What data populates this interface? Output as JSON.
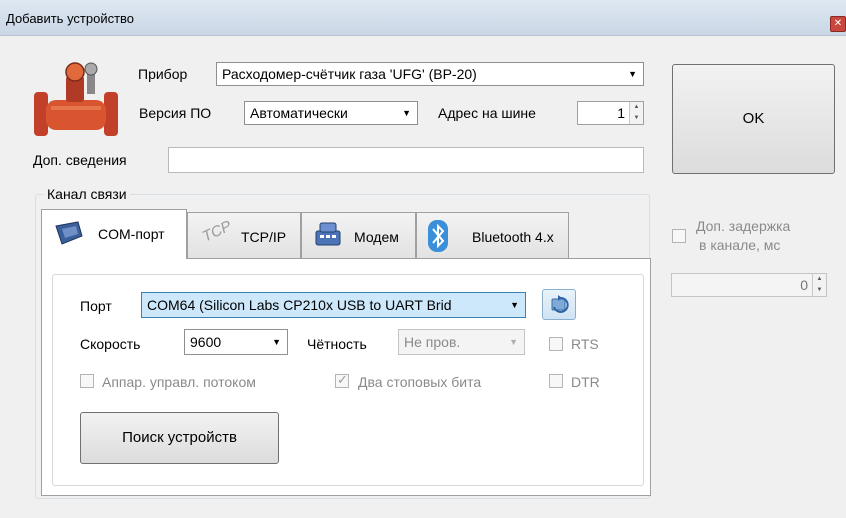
{
  "window": {
    "title": "Добавить устройство",
    "close_glyph": "✕"
  },
  "device": {
    "label": "Прибор",
    "selected": "Расходомер-счётчик газа 'UFG' (ВР-20)",
    "image_icon": "gas-flow-meter-image"
  },
  "firmware": {
    "label": "Версия ПО",
    "selected": "Автоматически"
  },
  "bus_address": {
    "label": "Адрес на шине",
    "value": "1"
  },
  "extra_info": {
    "label": "Доп. сведения",
    "value": ""
  },
  "ok_button": {
    "label": "OK"
  },
  "channel": {
    "group_title": "Канал связи",
    "tabs": [
      {
        "label": "COM-порт",
        "icon": "com-port-icon",
        "active": true
      },
      {
        "label": "TCP/IP",
        "icon": "tcp-icon",
        "active": false
      },
      {
        "label": "Модем",
        "icon": "modem-icon",
        "active": false
      },
      {
        "label": "Bluetooth 4.x",
        "icon": "bluetooth-icon",
        "active": false
      }
    ]
  },
  "com": {
    "port_label": "Порт",
    "port_selected": "COM64 (Silicon Labs CP210x USB to UART Brid",
    "refresh_icon": "refresh-icon",
    "speed_label": "Скорость",
    "speed_selected": "9600",
    "parity_label": "Чётность",
    "parity_selected": "Не пров.",
    "rts_label": "RTS",
    "rts_checked": false,
    "flow_label": "Аппар. управл. потоком",
    "flow_checked": false,
    "stopbits_label": "Два стоповых бита",
    "stopbits_checked": true,
    "dtr_label": "DTR",
    "dtr_checked": false,
    "search_button": "Поиск устройств"
  },
  "delay": {
    "label_line1": "Доп. задержка",
    "label_line2": "в канале, мс",
    "checked": false,
    "value": "0"
  },
  "colors": {
    "window_bg": "#f0f0f0",
    "selected_combo_bg": "#cde8fa",
    "disabled_text": "#8a8a8a"
  }
}
